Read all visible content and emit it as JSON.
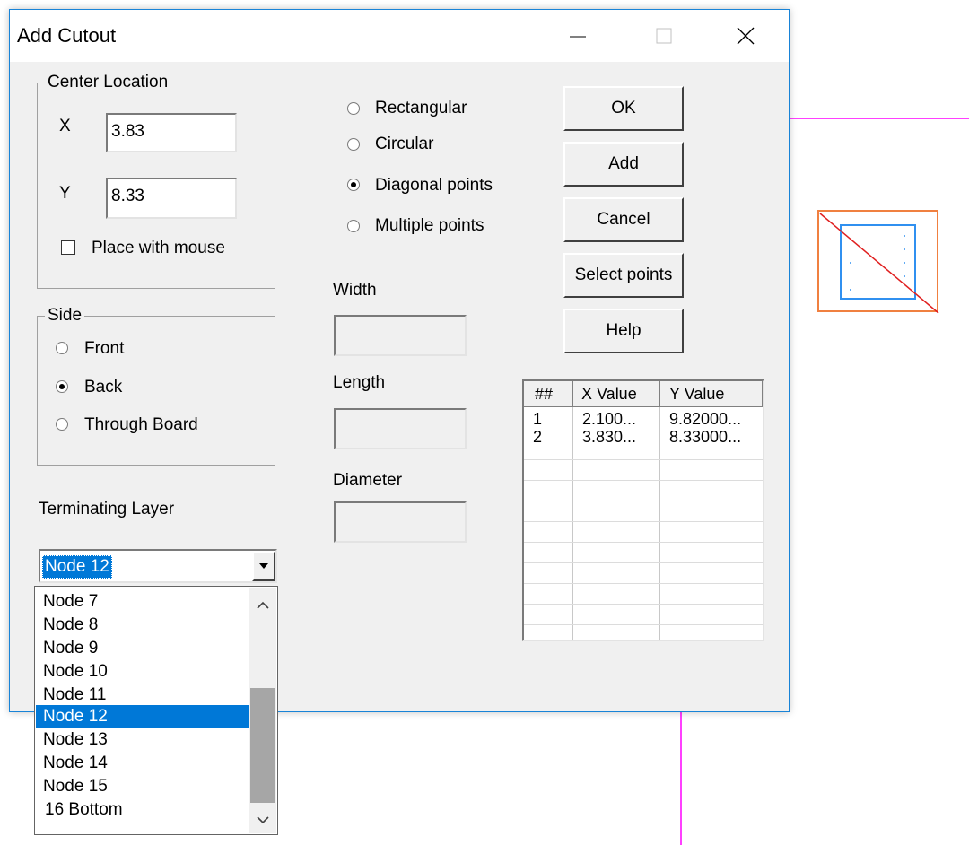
{
  "window": {
    "title": "Add Cutout",
    "accent_color": "#1883d7"
  },
  "center_location": {
    "title": "Center Location",
    "x_label": "X",
    "x_value": "3.83",
    "y_label": "Y",
    "y_value": "8.33",
    "place_with_mouse_label": "Place with mouse",
    "place_with_mouse_checked": false
  },
  "side": {
    "title": "Side",
    "options": [
      {
        "label": "Front",
        "selected": false
      },
      {
        "label": "Back",
        "selected": true
      },
      {
        "label": "Through Board",
        "selected": false
      }
    ]
  },
  "terminating_layer": {
    "label": "Terminating Layer",
    "selected": "Node 12",
    "options": [
      "Node 7",
      "Node 8",
      "Node 9",
      "Node 10",
      "Node 11",
      "Node 12",
      "Node 13",
      "Node 14",
      "Node 15",
      "16 Bottom"
    ],
    "selected_index": 5
  },
  "shape": {
    "options": [
      {
        "label": "Rectangular",
        "selected": false
      },
      {
        "label": "Circular",
        "selected": false
      },
      {
        "label": "Diagonal points",
        "selected": true
      },
      {
        "label": "Multiple points",
        "selected": false
      }
    ]
  },
  "dimensions": {
    "width_label": "Width",
    "width_value": "",
    "length_label": "Length",
    "length_value": "",
    "diameter_label": "Diameter",
    "diameter_value": ""
  },
  "buttons": {
    "ok": "OK",
    "add": "Add",
    "cancel": "Cancel",
    "select_points": "Select points",
    "help": "Help"
  },
  "points_table": {
    "columns": [
      "##",
      "X Value",
      "Y Value"
    ],
    "rows": [
      [
        "1",
        "2.100...",
        "9.82000..."
      ],
      [
        "2",
        "3.830...",
        "8.33000..."
      ]
    ]
  },
  "colors": {
    "selection": "#0078d7",
    "canvas_magenta": "#ff40ff",
    "canvas_orange": "#f08040",
    "canvas_blue": "#3090f0",
    "canvas_red": "#e02020"
  }
}
